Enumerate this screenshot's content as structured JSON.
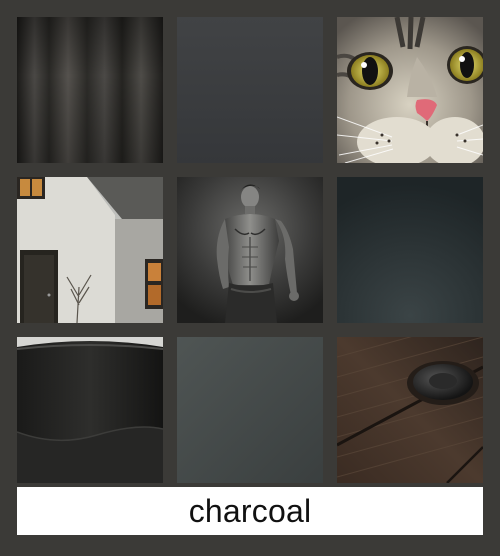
{
  "caption": {
    "label": "charcoal"
  },
  "colors": {
    "background": "#3b3a37",
    "caption_background": "#ffffff",
    "caption_text": "#111111"
  },
  "tiles": [
    {
      "name": "charcoal-curtain-fabric"
    },
    {
      "name": "charcoal-flat-swatch"
    },
    {
      "name": "tabby-cat-face"
    },
    {
      "name": "white-cottage-gray-roof"
    },
    {
      "name": "shirtless-man-portrait"
    },
    {
      "name": "dark-slate-gradient-swatch"
    },
    {
      "name": "charcoal-cup-rim"
    },
    {
      "name": "gray-green-gradient-swatch"
    },
    {
      "name": "dark-wood-planks-bolt"
    }
  ]
}
